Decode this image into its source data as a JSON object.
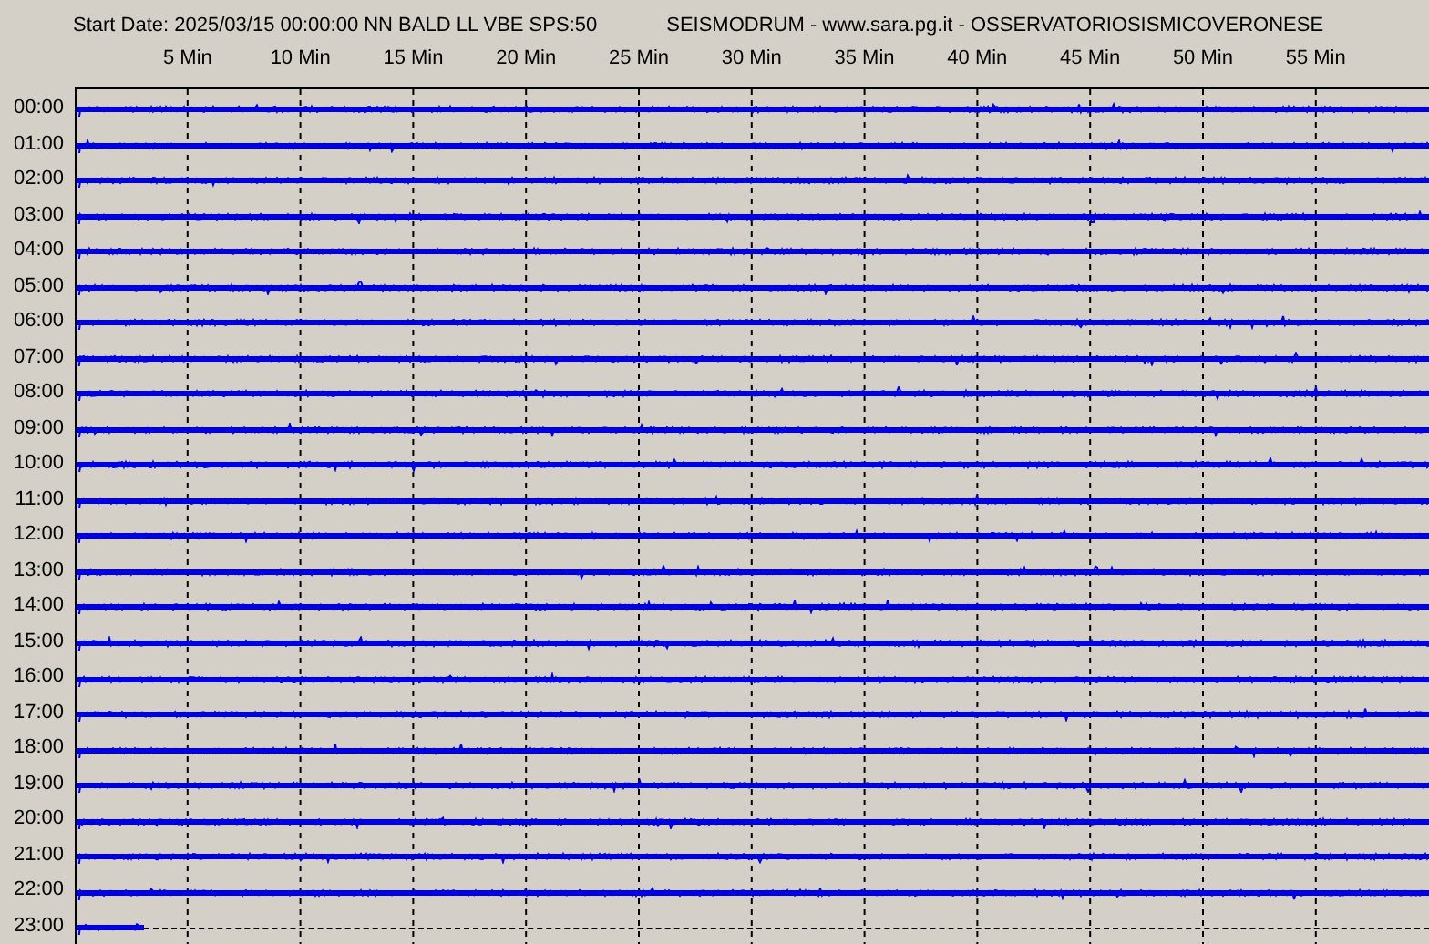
{
  "header": {
    "station": "Start Date: 2025/03/15 00:00:00 NN BALD LL VBE SPS:50",
    "source": "SEISMODRUM - www.sara.pg.it - OSSERVATORIOSISMICOVERONESE"
  },
  "minute_ticks": [
    "5 Min",
    "10 Min",
    "15 Min",
    "20 Min",
    "25 Min",
    "30 Min",
    "35 Min",
    "40 Min",
    "45 Min",
    "50 Min",
    "55 Min"
  ],
  "rows": [
    {
      "hour": "00:00",
      "level": 1
    },
    {
      "hour": "01:00",
      "level": 1
    },
    {
      "hour": "02:00",
      "level": 1
    },
    {
      "hour": "03:00",
      "level": 1
    },
    {
      "hour": "04:00",
      "level": 1
    },
    {
      "hour": "05:00",
      "level": 1
    },
    {
      "hour": "06:00",
      "level": 1
    },
    {
      "hour": "07:00",
      "level": 1
    },
    {
      "hour": "08:00",
      "level": 1
    },
    {
      "hour": "09:00",
      "level": 1
    },
    {
      "hour": "10:00",
      "level": 1
    },
    {
      "hour": "11:00",
      "level": 1
    },
    {
      "hour": "12:00",
      "level": 1
    },
    {
      "hour": "13:00",
      "level": 1
    },
    {
      "hour": "14:00",
      "level": 1
    },
    {
      "hour": "15:00",
      "level": 1
    },
    {
      "hour": "16:00",
      "level": 1
    },
    {
      "hour": "17:00",
      "level": 1
    },
    {
      "hour": "18:00",
      "level": 1
    },
    {
      "hour": "19:00",
      "level": 1
    },
    {
      "hour": "20:00",
      "level": 1
    },
    {
      "hour": "21:00",
      "level": 1
    },
    {
      "hour": "22:00",
      "level": 1
    },
    {
      "hour": "23:00",
      "level": 0.05
    }
  ]
}
